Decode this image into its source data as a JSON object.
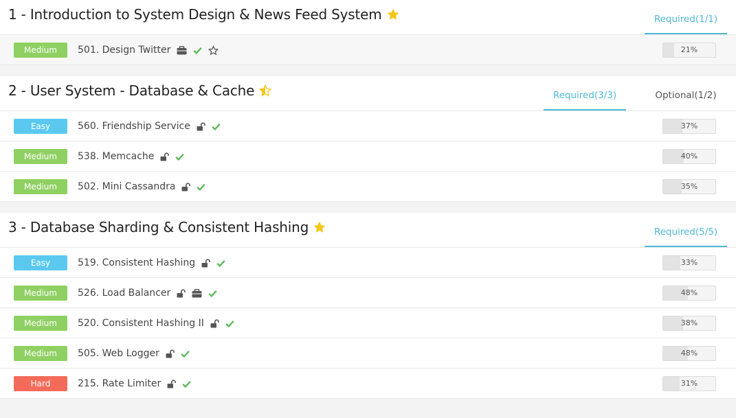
{
  "sections": [
    {
      "title": "1 - Introduction to System Design & News Feed System",
      "star": "full",
      "tabs": [
        {
          "label": "Required(1/1)",
          "active": true
        }
      ],
      "problems": [
        {
          "difficulty": "Medium",
          "name": "501. Design Twitter",
          "icons": [
            "briefcase-icon",
            "check-icon",
            "star-outline-icon"
          ],
          "progress": 21,
          "progress_label": "21%"
        }
      ]
    },
    {
      "title": "2 - User System - Database & Cache",
      "star": "half",
      "tabs": [
        {
          "label": "Required(3/3)",
          "active": true
        },
        {
          "label": "Optional(1/2)",
          "active": false
        }
      ],
      "problems": [
        {
          "difficulty": "Easy",
          "name": "560. Friendship Service",
          "icons": [
            "unlock-icon",
            "check-icon"
          ],
          "progress": 37,
          "progress_label": "37%"
        },
        {
          "difficulty": "Medium",
          "name": "538. Memcache",
          "icons": [
            "unlock-icon",
            "check-icon"
          ],
          "progress": 40,
          "progress_label": "40%"
        },
        {
          "difficulty": "Medium",
          "name": "502. Mini Cassandra",
          "icons": [
            "unlock-icon",
            "check-icon"
          ],
          "progress": 35,
          "progress_label": "35%"
        }
      ]
    },
    {
      "title": "3 - Database Sharding & Consistent Hashing",
      "star": "full",
      "tabs": [
        {
          "label": "Required(5/5)",
          "active": true
        }
      ],
      "problems": [
        {
          "difficulty": "Easy",
          "name": "519. Consistent Hashing",
          "icons": [
            "unlock-icon",
            "check-icon"
          ],
          "progress": 33,
          "progress_label": "33%"
        },
        {
          "difficulty": "Medium",
          "name": "526. Load Balancer",
          "icons": [
            "unlock-icon",
            "briefcase-icon",
            "check-icon"
          ],
          "progress": 48,
          "progress_label": "48%"
        },
        {
          "difficulty": "Medium",
          "name": "520. Consistent Hashing II",
          "icons": [
            "unlock-icon",
            "check-icon"
          ],
          "progress": 38,
          "progress_label": "38%"
        },
        {
          "difficulty": "Medium",
          "name": "505. Web Logger",
          "icons": [
            "unlock-icon",
            "check-icon"
          ],
          "progress": 48,
          "progress_label": "48%"
        },
        {
          "difficulty": "Hard",
          "name": "215. Rate Limiter",
          "icons": [
            "unlock-icon",
            "check-icon"
          ],
          "progress": 31,
          "progress_label": "31%"
        }
      ]
    }
  ],
  "colors": {
    "accent": "#4fb9d8",
    "easy": "#5bc9ef",
    "medium": "#8fd063",
    "hard": "#f46b5a",
    "check": "#5cb85c",
    "star": "#f5c518"
  }
}
